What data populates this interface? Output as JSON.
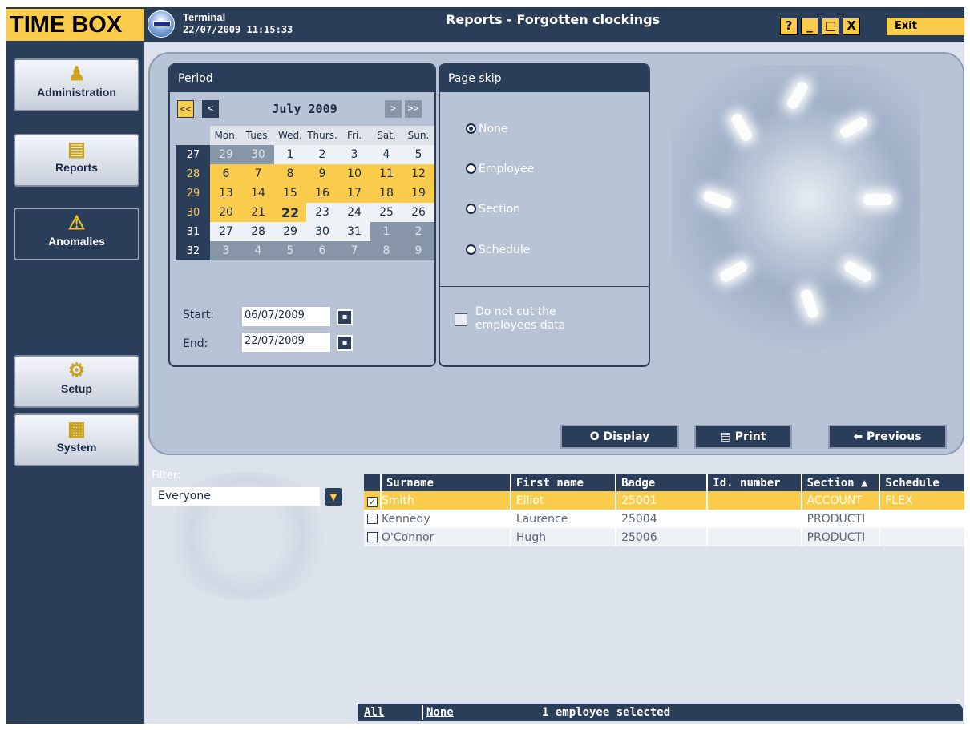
{
  "app": {
    "logo": "TIME BOX",
    "title": "Reports - Forgotten clockings"
  },
  "terminal": {
    "label": "Terminal",
    "datetime": "22/07/2009 11:15:33"
  },
  "window_controls": {
    "help": "?",
    "minimize": "_",
    "maximize": "□",
    "close": "X",
    "exit": "Exit"
  },
  "sidebar": {
    "items": [
      {
        "label": "Administration",
        "icon": "administration-icon"
      },
      {
        "label": "Reports",
        "icon": "reports-icon"
      },
      {
        "label": "Anomalies",
        "icon": "warning-icon"
      },
      {
        "label": "Setup",
        "icon": "gear-icon"
      },
      {
        "label": "System",
        "icon": "system-icon"
      }
    ]
  },
  "period": {
    "title": "Period",
    "month": "July 2009",
    "nav": {
      "first": "<<",
      "prev": "<",
      "next": ">",
      "last": ">>"
    },
    "days_of_week": [
      "Mon.",
      "Tues.",
      "Wed.",
      "Thurs.",
      "Fri.",
      "Sat.",
      "Sun."
    ],
    "weeks": [
      {
        "wk": "27",
        "days": [
          "29",
          "30",
          "1",
          "2",
          "3",
          "4",
          "5"
        ]
      },
      {
        "wk": "28",
        "days": [
          "6",
          "7",
          "8",
          "9",
          "10",
          "11",
          "12"
        ]
      },
      {
        "wk": "29",
        "days": [
          "13",
          "14",
          "15",
          "16",
          "17",
          "18",
          "19"
        ]
      },
      {
        "wk": "30",
        "days": [
          "20",
          "21",
          "22",
          "23",
          "24",
          "25",
          "26"
        ]
      },
      {
        "wk": "31",
        "days": [
          "27",
          "28",
          "29",
          "30",
          "31",
          "1",
          "2"
        ]
      },
      {
        "wk": "32",
        "days": [
          "3",
          "4",
          "5",
          "6",
          "7",
          "8",
          "9"
        ]
      }
    ],
    "start_label": "Start:",
    "start": "06/07/2009",
    "end_label": "End:",
    "end": "22/07/2009"
  },
  "page_skip": {
    "title": "Page skip",
    "options": [
      "None",
      "Employee",
      "Section",
      "Schedule"
    ],
    "selected": "None",
    "no_cut_label": "Do not cut the employees data"
  },
  "actions": {
    "display": "Display",
    "print": "Print",
    "previous": "Previous"
  },
  "filter": {
    "label": "Filter:",
    "value": "Everyone"
  },
  "table": {
    "columns": [
      "Surname",
      "First name",
      "Badge",
      "Id. number",
      "Section ▲",
      "Schedule"
    ],
    "rows": [
      {
        "checked": true,
        "surname": "Smith",
        "first_name": "Elliot",
        "badge": "25001",
        "id_number": "",
        "section": "ACCOUNT",
        "schedule": "FLEX"
      },
      {
        "checked": false,
        "surname": "Kennedy",
        "first_name": "Laurence",
        "badge": "25004",
        "id_number": "",
        "section": "PRODUCTI",
        "schedule": ""
      },
      {
        "checked": false,
        "surname": "O'Connor",
        "first_name": "Hugh",
        "badge": "25006",
        "id_number": "",
        "section": "PRODUCTI",
        "schedule": ""
      }
    ]
  },
  "footer": {
    "all": "All",
    "none": "None",
    "status": "1 employee selected"
  },
  "colors": {
    "navy": "#2b3e59",
    "gold": "#fbcb4c",
    "panel": "#b8c4d6",
    "background": "#dde3ec"
  }
}
